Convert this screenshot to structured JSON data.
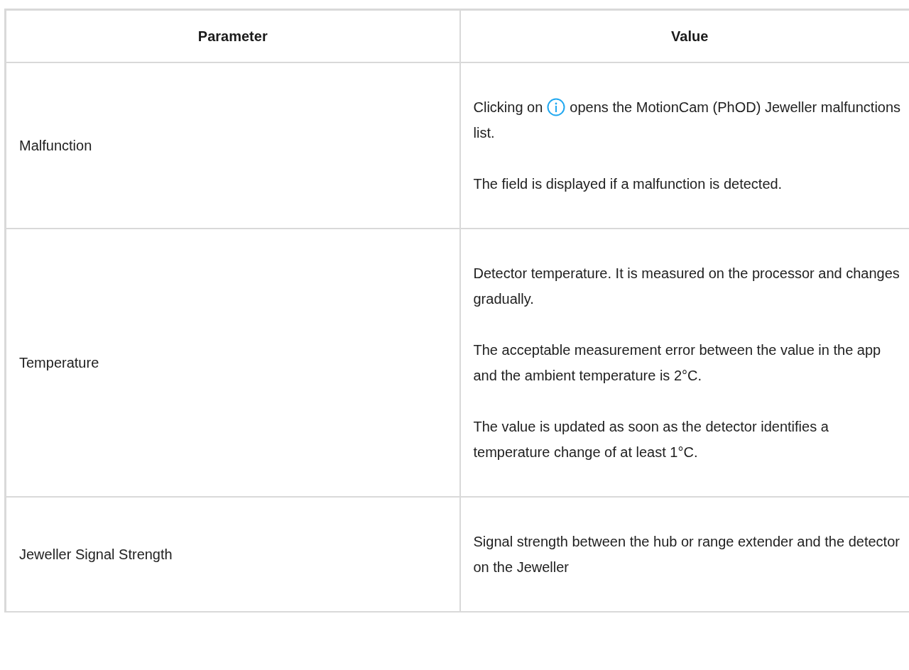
{
  "table": {
    "columns": [
      "Parameter",
      "Value"
    ],
    "rows": [
      {
        "parameter": "Malfunction",
        "paragraphs": [
          {
            "kind": "icon_inline",
            "before": "Clicking on",
            "after": "opens the MotionCam (PhOD) Jeweller malfunctions list."
          },
          {
            "kind": "text",
            "text": "The field is displayed if a malfunction is detected."
          }
        ]
      },
      {
        "parameter": "Temperature",
        "paragraphs": [
          {
            "kind": "text",
            "text": "Detector temperature. It is measured on the processor and changes gradually."
          },
          {
            "kind": "text",
            "text": "The acceptable measurement error between the value in the app and the ambient temperature is 2°C."
          },
          {
            "kind": "text",
            "text": "The value is updated as soon as the detector identifies a temperature change of at least 1°C."
          }
        ]
      },
      {
        "parameter": "Jeweller Signal Strength",
        "paragraphs": [
          {
            "kind": "text",
            "text": "Signal strength between the hub or range extender and the detector on the Jeweller"
          }
        ]
      }
    ]
  }
}
